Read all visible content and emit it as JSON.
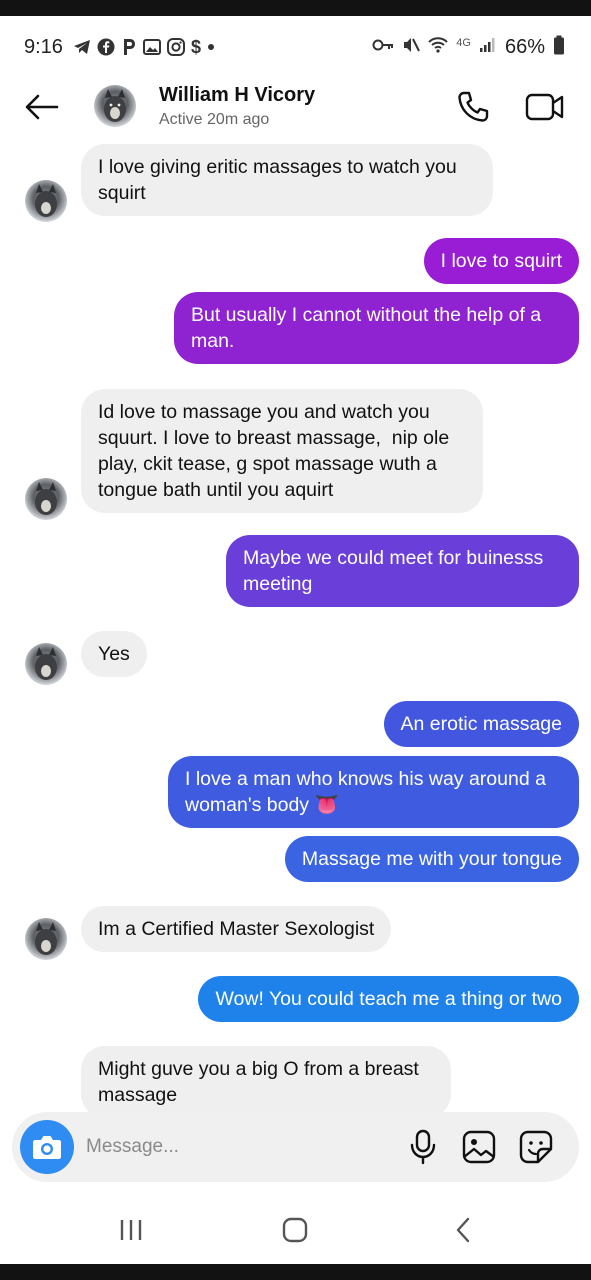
{
  "status_bar": {
    "time": "9:16",
    "network": "4G",
    "battery": "66%",
    "icons": [
      "telegram-icon",
      "facebook-icon",
      "pinterest-icon",
      "gallery-icon",
      "instagram-icon",
      "dollar-icon",
      "dot-icon",
      "key-icon",
      "mute-icon",
      "wifi-icon",
      "signal-icon",
      "battery-icon"
    ],
    "dollar_glyph": "$"
  },
  "header": {
    "contact_name": "William H Vicory",
    "contact_status": "Active 20m ago"
  },
  "messages": [
    {
      "side": "received",
      "text": "I love giving eritic massages to watch you squirt",
      "avatar": true
    },
    {
      "side": "sent",
      "text": "I love to squirt",
      "color": "#9a1dd6"
    },
    {
      "side": "sent",
      "text": "But usually I cannot without the help of a man.",
      "color": "#8f22d1"
    },
    {
      "side": "received",
      "text": "Id love to massage you and watch you squurt. I love to breast massage,  nip ole play, ckit tease, g spot massage wuth a tongue bath until you aquirt",
      "avatar": true
    },
    {
      "side": "sent",
      "text": "Maybe we could meet for buinesss meeting",
      "color": "#6a3fd9"
    },
    {
      "side": "received",
      "text": "Yes",
      "avatar": true
    },
    {
      "side": "sent",
      "text": "An erotic massage",
      "color": "#4356df"
    },
    {
      "side": "sent",
      "text": "I love a man who knows his way around a woman's body 👅",
      "color": "#3f5ce0"
    },
    {
      "side": "sent",
      "text": "Massage me with your tongue",
      "color": "#3a64e2"
    },
    {
      "side": "received",
      "text": "Im a Certified Master Sexologist",
      "avatar": true
    },
    {
      "side": "sent",
      "text": "Wow! You could teach me a thing or two",
      "color": "#1f82ea"
    },
    {
      "side": "received",
      "text": "Might guve you a big O from a breast massage",
      "avatar": false
    }
  ],
  "composer": {
    "placeholder": "Message..."
  },
  "colors": {
    "camera_button": "#2f8cf2",
    "received_bubble": "#efefef"
  }
}
